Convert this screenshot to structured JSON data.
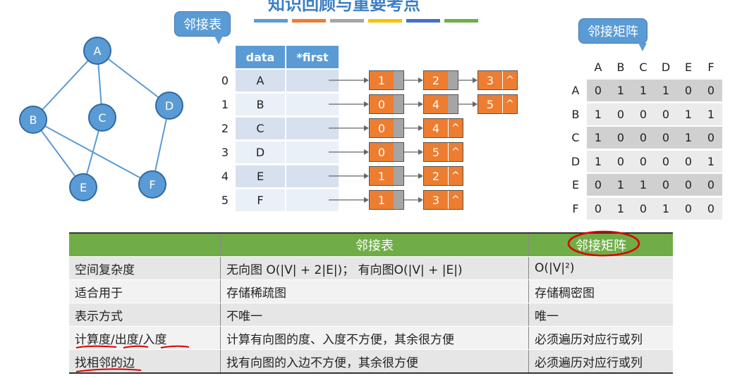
{
  "title": "知识回顾与重要考点",
  "callouts": {
    "adj_list": "邻接表",
    "adj_matrix": "邻接矩阵"
  },
  "stripe_colors": [
    "#5b9bd5",
    "#ed7d31",
    "#a5a5a5",
    "#ffc000",
    "#4472c4",
    "#70ad47"
  ],
  "graph": {
    "vertices": [
      "A",
      "B",
      "C",
      "D",
      "E",
      "F"
    ],
    "edges": [
      [
        "A",
        "B"
      ],
      [
        "A",
        "C"
      ],
      [
        "A",
        "D"
      ],
      [
        "B",
        "E"
      ],
      [
        "B",
        "F"
      ],
      [
        "C",
        "E"
      ],
      [
        "D",
        "F"
      ]
    ]
  },
  "adj_list": {
    "headers": [
      "data",
      "*first"
    ],
    "indices": [
      "0",
      "1",
      "2",
      "3",
      "4",
      "5"
    ],
    "data": [
      "A",
      "B",
      "C",
      "D",
      "E",
      "F"
    ],
    "chains": [
      [
        "1",
        "2",
        "3"
      ],
      [
        "0",
        "4",
        "5"
      ],
      [
        "0",
        "4"
      ],
      [
        "0",
        "5"
      ],
      [
        "1",
        "2"
      ],
      [
        "1",
        "3"
      ]
    ],
    "null_mark": "^"
  },
  "matrix": {
    "labels": [
      "A",
      "B",
      "C",
      "D",
      "E",
      "F"
    ],
    "rows": [
      [
        "0",
        "1",
        "1",
        "1",
        "0",
        "0"
      ],
      [
        "1",
        "0",
        "0",
        "0",
        "1",
        "1"
      ],
      [
        "1",
        "0",
        "0",
        "0",
        "1",
        "0"
      ],
      [
        "1",
        "0",
        "0",
        "0",
        "0",
        "1"
      ],
      [
        "0",
        "1",
        "1",
        "0",
        "0",
        "0"
      ],
      [
        "0",
        "1",
        "0",
        "1",
        "0",
        "0"
      ]
    ]
  },
  "compare": {
    "headers": [
      "",
      "邻接表",
      "邻接矩阵"
    ],
    "rows": [
      [
        "空间复杂度",
        "无向图 O(|V| + 2|E|)； 有向图O(|V| + |E|)",
        "O(|V|²)"
      ],
      [
        "适合用于",
        "存储稀疏图",
        "存储稠密图"
      ],
      [
        "表示方式",
        "不唯一",
        "唯一"
      ],
      [
        "计算度/出度/入度",
        "计算有向图的度、入度不方便，其余很方便",
        "必须遍历对应行或列"
      ],
      [
        "找相邻的边",
        "找有向图的入边不方便，其余很方便",
        "必须遍历对应行或列"
      ]
    ]
  }
}
